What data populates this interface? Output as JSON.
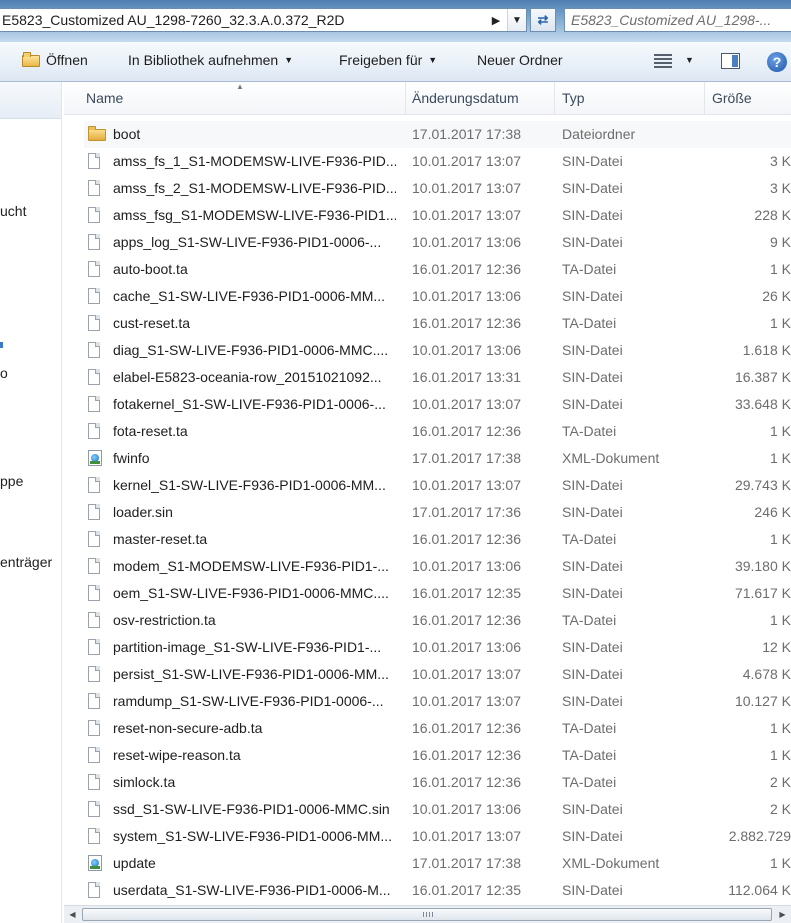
{
  "address": {
    "path": "E5823_Customized AU_1298-7260_32.3.A.0.372_R2D",
    "search_placeholder": "E5823_Customized AU_1298-..."
  },
  "toolbar": {
    "open": "Öffnen",
    "library": "In Bibliothek aufnehmen",
    "share": "Freigeben für",
    "new_folder": "Neuer Ordner"
  },
  "nav": {
    "fragments": [
      "ucht",
      "o",
      "ppe",
      "enträger"
    ]
  },
  "columns": {
    "name": "Name",
    "date": "Änderungsdatum",
    "type": "Typ",
    "size": "Größe"
  },
  "files": [
    {
      "name": "boot",
      "date": "17.01.2017 17:38",
      "type": "Dateiordner",
      "size": "",
      "icon": "folder-icon"
    },
    {
      "name": "amss_fs_1_S1-MODEMSW-LIVE-F936-PID...",
      "date": "10.01.2017 13:07",
      "type": "SIN-Datei",
      "size": "3 K",
      "icon": "file-icon"
    },
    {
      "name": "amss_fs_2_S1-MODEMSW-LIVE-F936-PID...",
      "date": "10.01.2017 13:07",
      "type": "SIN-Datei",
      "size": "3 K",
      "icon": "file-icon"
    },
    {
      "name": "amss_fsg_S1-MODEMSW-LIVE-F936-PID1...",
      "date": "10.01.2017 13:07",
      "type": "SIN-Datei",
      "size": "228 K",
      "icon": "file-icon"
    },
    {
      "name": "apps_log_S1-SW-LIVE-F936-PID1-0006-...",
      "date": "10.01.2017 13:06",
      "type": "SIN-Datei",
      "size": "9 K",
      "icon": "file-icon"
    },
    {
      "name": "auto-boot.ta",
      "date": "16.01.2017 12:36",
      "type": "TA-Datei",
      "size": "1 K",
      "icon": "file-icon"
    },
    {
      "name": "cache_S1-SW-LIVE-F936-PID1-0006-MM...",
      "date": "10.01.2017 13:06",
      "type": "SIN-Datei",
      "size": "26 K",
      "icon": "file-icon"
    },
    {
      "name": "cust-reset.ta",
      "date": "16.01.2017 12:36",
      "type": "TA-Datei",
      "size": "1 K",
      "icon": "file-icon"
    },
    {
      "name": "diag_S1-SW-LIVE-F936-PID1-0006-MMC....",
      "date": "10.01.2017 13:06",
      "type": "SIN-Datei",
      "size": "1.618 K",
      "icon": "file-icon"
    },
    {
      "name": "elabel-E5823-oceania-row_20151021092...",
      "date": "16.01.2017 13:31",
      "type": "SIN-Datei",
      "size": "16.387 K",
      "icon": "file-icon"
    },
    {
      "name": "fotakernel_S1-SW-LIVE-F936-PID1-0006-...",
      "date": "10.01.2017 13:07",
      "type": "SIN-Datei",
      "size": "33.648 K",
      "icon": "file-icon"
    },
    {
      "name": "fota-reset.ta",
      "date": "16.01.2017 12:36",
      "type": "TA-Datei",
      "size": "1 K",
      "icon": "file-icon"
    },
    {
      "name": "fwinfo",
      "date": "17.01.2017 17:38",
      "type": "XML-Dokument",
      "size": "1 K",
      "icon": "xml-icon"
    },
    {
      "name": "kernel_S1-SW-LIVE-F936-PID1-0006-MM...",
      "date": "10.01.2017 13:07",
      "type": "SIN-Datei",
      "size": "29.743 K",
      "icon": "file-icon"
    },
    {
      "name": "loader.sin",
      "date": "17.01.2017 17:36",
      "type": "SIN-Datei",
      "size": "246 K",
      "icon": "file-icon"
    },
    {
      "name": "master-reset.ta",
      "date": "16.01.2017 12:36",
      "type": "TA-Datei",
      "size": "1 K",
      "icon": "file-icon"
    },
    {
      "name": "modem_S1-MODEMSW-LIVE-F936-PID1-...",
      "date": "10.01.2017 13:06",
      "type": "SIN-Datei",
      "size": "39.180 K",
      "icon": "file-icon"
    },
    {
      "name": "oem_S1-SW-LIVE-F936-PID1-0006-MMC....",
      "date": "16.01.2017 12:35",
      "type": "SIN-Datei",
      "size": "71.617 K",
      "icon": "file-icon"
    },
    {
      "name": "osv-restriction.ta",
      "date": "16.01.2017 12:36",
      "type": "TA-Datei",
      "size": "1 K",
      "icon": "file-icon"
    },
    {
      "name": "partition-image_S1-SW-LIVE-F936-PID1-...",
      "date": "10.01.2017 13:06",
      "type": "SIN-Datei",
      "size": "12 K",
      "icon": "file-icon"
    },
    {
      "name": "persist_S1-SW-LIVE-F936-PID1-0006-MM...",
      "date": "10.01.2017 13:07",
      "type": "SIN-Datei",
      "size": "4.678 K",
      "icon": "file-icon"
    },
    {
      "name": "ramdump_S1-SW-LIVE-F936-PID1-0006-...",
      "date": "10.01.2017 13:07",
      "type": "SIN-Datei",
      "size": "10.127 K",
      "icon": "file-icon"
    },
    {
      "name": "reset-non-secure-adb.ta",
      "date": "16.01.2017 12:36",
      "type": "TA-Datei",
      "size": "1 K",
      "icon": "file-icon"
    },
    {
      "name": "reset-wipe-reason.ta",
      "date": "16.01.2017 12:36",
      "type": "TA-Datei",
      "size": "1 K",
      "icon": "file-icon"
    },
    {
      "name": "simlock.ta",
      "date": "16.01.2017 12:36",
      "type": "TA-Datei",
      "size": "2 K",
      "icon": "file-icon"
    },
    {
      "name": "ssd_S1-SW-LIVE-F936-PID1-0006-MMC.sin",
      "date": "10.01.2017 13:06",
      "type": "SIN-Datei",
      "size": "2 K",
      "icon": "file-icon"
    },
    {
      "name": "system_S1-SW-LIVE-F936-PID1-0006-MM...",
      "date": "10.01.2017 13:07",
      "type": "SIN-Datei",
      "size": "2.882.729",
      "icon": "file-icon"
    },
    {
      "name": "update",
      "date": "17.01.2017 17:38",
      "type": "XML-Dokument",
      "size": "1 K",
      "icon": "xml-icon"
    },
    {
      "name": "userdata_S1-SW-LIVE-F936-PID1-0006-M...",
      "date": "16.01.2017 12:35",
      "type": "SIN-Datei",
      "size": "112.064 K",
      "icon": "file-icon"
    }
  ]
}
